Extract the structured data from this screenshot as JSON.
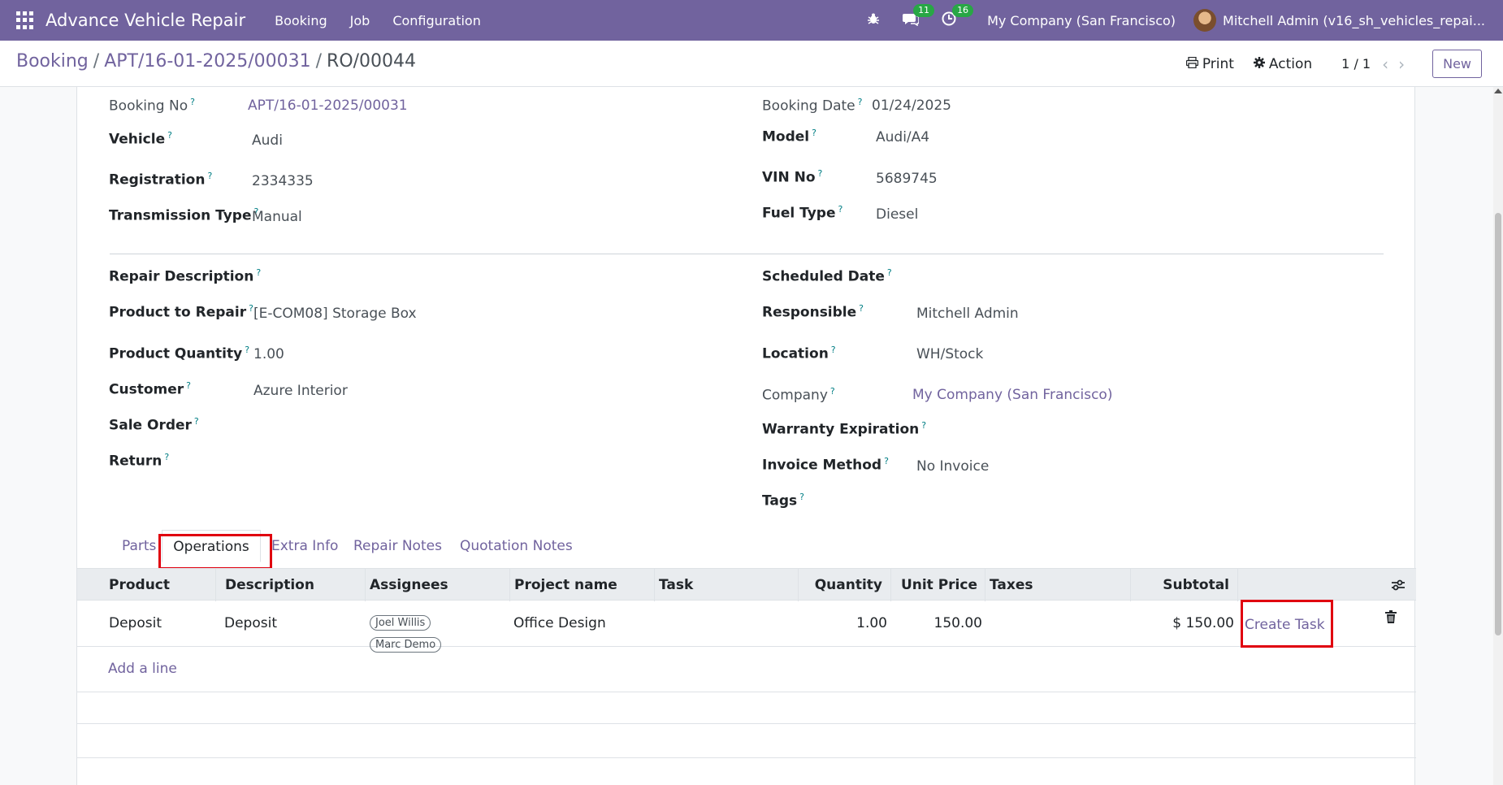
{
  "navbar": {
    "app_title": "Advance Vehicle Repair",
    "menu": [
      "Booking",
      "Job",
      "Configuration"
    ],
    "messages_count": "11",
    "activities_count": "16",
    "company": "My Company (San Francisco)",
    "user": "Mitchell Admin (v16_sh_vehicles_repai..."
  },
  "breadcrumb": {
    "root": "Booking",
    "parent": "APT/16-01-2025/00031",
    "current": "RO/00044"
  },
  "control": {
    "print_label": "Print",
    "action_label": "Action",
    "pager": "1 / 1",
    "new_label": "New"
  },
  "fields": {
    "booking_no": {
      "label": "Booking No",
      "value": "APT/16-01-2025/00031"
    },
    "booking_date": {
      "label": "Booking Date",
      "value": "01/24/2025"
    },
    "vehicle": {
      "label": "Vehicle",
      "value": "Audi"
    },
    "model": {
      "label": "Model",
      "value": "Audi/A4"
    },
    "registration": {
      "label": "Registration",
      "value": "2334335"
    },
    "vin_no": {
      "label": "VIN No",
      "value": "5689745"
    },
    "transmission": {
      "label": "Transmission Type",
      "value": "Manual"
    },
    "fuel_type": {
      "label": "Fuel Type",
      "value": "Diesel"
    },
    "repair_description": {
      "label": "Repair Description",
      "value": ""
    },
    "scheduled_date": {
      "label": "Scheduled Date",
      "value": ""
    },
    "product_to_repair": {
      "label": "Product to Repair",
      "value": "[E-COM08] Storage Box"
    },
    "responsible": {
      "label": "Responsible",
      "value": "Mitchell Admin"
    },
    "product_quantity": {
      "label": "Product Quantity",
      "value": "1.00"
    },
    "location": {
      "label": "Location",
      "value": "WH/Stock"
    },
    "customer": {
      "label": "Customer",
      "value": "Azure Interior"
    },
    "company": {
      "label": "Company",
      "value": "My Company (San Francisco)"
    },
    "sale_order": {
      "label": "Sale Order",
      "value": ""
    },
    "warranty_expiration": {
      "label": "Warranty Expiration",
      "value": ""
    },
    "return": {
      "label": "Return",
      "value": ""
    },
    "invoice_method": {
      "label": "Invoice Method",
      "value": "No Invoice"
    },
    "tags": {
      "label": "Tags",
      "value": ""
    }
  },
  "tabs": [
    "Parts",
    "Operations",
    "Extra Info",
    "Repair Notes",
    "Quotation Notes"
  ],
  "active_tab": "Operations",
  "table": {
    "headers": [
      "Product",
      "Description",
      "Assignees",
      "Project name",
      "Task",
      "Quantity",
      "Unit Price",
      "Taxes",
      "Subtotal"
    ],
    "rows": [
      {
        "product": "Deposit",
        "description": "Deposit",
        "assignees": [
          "Joel Willis",
          "Marc Demo"
        ],
        "project": "Office Design",
        "task": "",
        "quantity": "1.00",
        "unit_price": "150.00",
        "taxes": "",
        "subtotal": "$ 150.00",
        "action_label": "Create Task"
      }
    ],
    "add_line_label": "Add a line"
  },
  "colors": {
    "brand": "#71639e",
    "highlight": "#e0000f",
    "badge": "#28a745"
  }
}
